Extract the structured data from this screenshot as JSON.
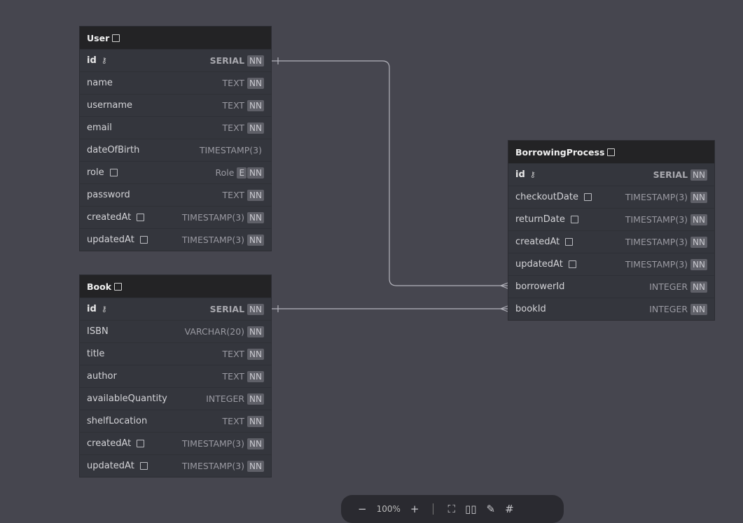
{
  "tables": {
    "user": {
      "title": "User",
      "rows": [
        {
          "name": "id",
          "type": "SERIAL",
          "badges": [
            "NN"
          ],
          "pk": true
        },
        {
          "name": "name",
          "type": "TEXT",
          "badges": [
            "NN"
          ]
        },
        {
          "name": "username",
          "type": "TEXT",
          "badges": [
            "NN"
          ]
        },
        {
          "name": "email",
          "type": "TEXT",
          "badges": [
            "NN"
          ]
        },
        {
          "name": "dateOfBirth",
          "type": "TIMESTAMP(3)",
          "badges": []
        },
        {
          "name": "role",
          "type": "Role",
          "badges": [
            "E",
            "NN"
          ],
          "note": true
        },
        {
          "name": "password",
          "type": "TEXT",
          "badges": [
            "NN"
          ]
        },
        {
          "name": "createdAt",
          "type": "TIMESTAMP(3)",
          "badges": [
            "NN"
          ],
          "note": true
        },
        {
          "name": "updatedAt",
          "type": "TIMESTAMP(3)",
          "badges": [
            "NN"
          ],
          "note": true
        }
      ]
    },
    "book": {
      "title": "Book",
      "rows": [
        {
          "name": "id",
          "type": "SERIAL",
          "badges": [
            "NN"
          ],
          "pk": true
        },
        {
          "name": "ISBN",
          "type": "VARCHAR(20)",
          "badges": [
            "NN"
          ]
        },
        {
          "name": "title",
          "type": "TEXT",
          "badges": [
            "NN"
          ]
        },
        {
          "name": "author",
          "type": "TEXT",
          "badges": [
            "NN"
          ]
        },
        {
          "name": "availableQuantity",
          "type": "INTEGER",
          "badges": [
            "NN"
          ]
        },
        {
          "name": "shelfLocation",
          "type": "TEXT",
          "badges": [
            "NN"
          ]
        },
        {
          "name": "createdAt",
          "type": "TIMESTAMP(3)",
          "badges": [
            "NN"
          ],
          "note": true
        },
        {
          "name": "updatedAt",
          "type": "TIMESTAMP(3)",
          "badges": [
            "NN"
          ],
          "note": true
        }
      ]
    },
    "borrowing": {
      "title": "BorrowingProcess",
      "rows": [
        {
          "name": "id",
          "type": "SERIAL",
          "badges": [
            "NN"
          ],
          "pk": true
        },
        {
          "name": "checkoutDate",
          "type": "TIMESTAMP(3)",
          "badges": [
            "NN"
          ],
          "note": true
        },
        {
          "name": "returnDate",
          "type": "TIMESTAMP(3)",
          "badges": [
            "NN"
          ],
          "note": true
        },
        {
          "name": "createdAt",
          "type": "TIMESTAMP(3)",
          "badges": [
            "NN"
          ],
          "note": true
        },
        {
          "name": "updatedAt",
          "type": "TIMESTAMP(3)",
          "badges": [
            "NN"
          ],
          "note": true
        },
        {
          "name": "borrowerId",
          "type": "INTEGER",
          "badges": [
            "NN"
          ]
        },
        {
          "name": "bookId",
          "type": "INTEGER",
          "badges": [
            "NN"
          ]
        }
      ]
    }
  },
  "relations": [
    {
      "from": "User.id",
      "to": "BorrowingProcess.borrowerId",
      "type": "one-to-many"
    },
    {
      "from": "Book.id",
      "to": "BorrowingProcess.bookId",
      "type": "one-to-many"
    }
  ],
  "toolbar": {
    "zoom": "100%",
    "icons": [
      "zoom-out-icon",
      "zoom-in-icon",
      "fit-view-icon",
      "layout-icon",
      "eraser-icon",
      "grid-icon"
    ]
  }
}
